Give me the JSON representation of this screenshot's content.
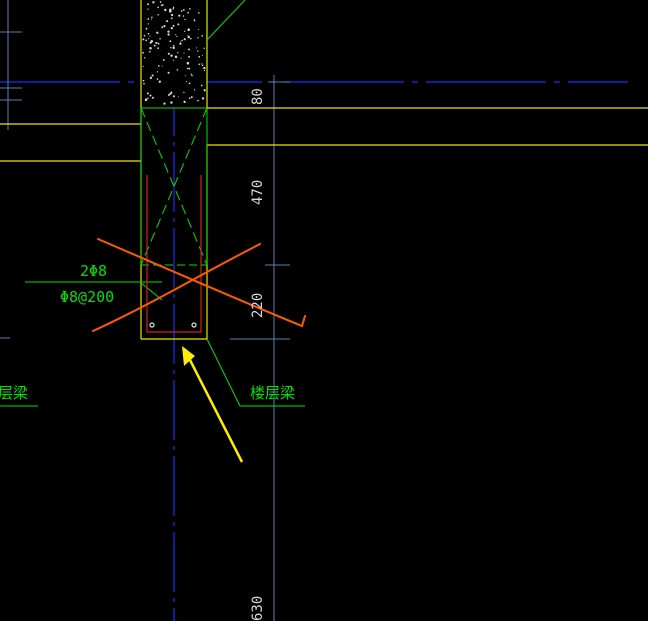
{
  "drawing": {
    "background": "#000000",
    "colors": {
      "axis": "#1a2cff",
      "outline": "#e6e600",
      "green": "#00e000",
      "stirrup": "#d22020",
      "cross": "#ff5a00",
      "arrow": "#ffee00",
      "dim": "#5a7fb0",
      "dim_text": "#d8d8d8",
      "fill_dots": "#d8d8d8"
    },
    "dimensions": {
      "d80": "80",
      "d470": "470",
      "d220": "220",
      "d630": "630"
    },
    "labels": {
      "rebar_top": "2Φ8",
      "rebar_bottom": "Φ8@200",
      "beam_label_left": "层梁",
      "beam_label_right": "楼层梁"
    }
  }
}
